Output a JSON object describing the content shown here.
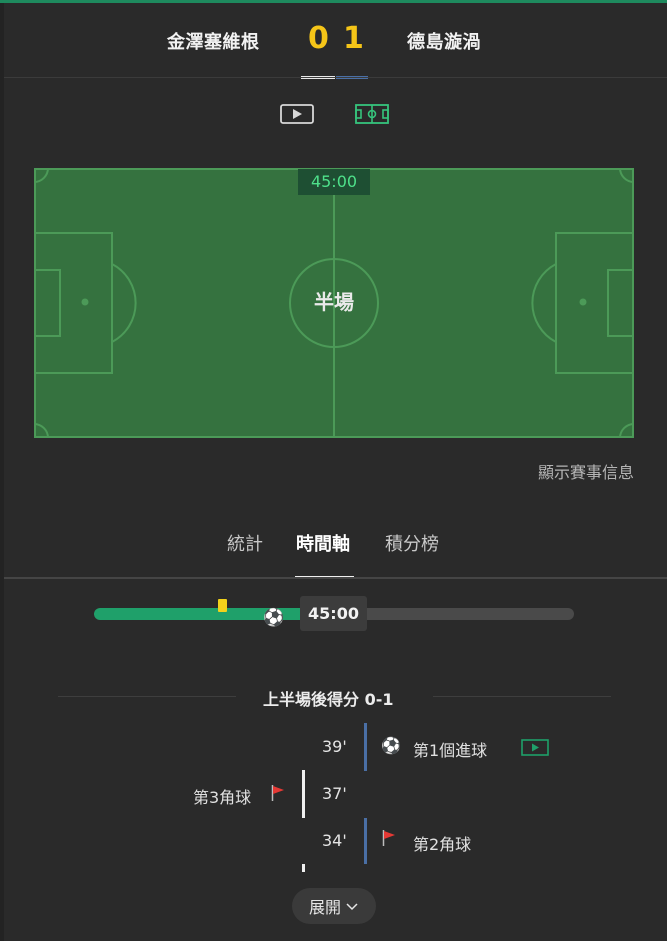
{
  "match": {
    "home_team": "金澤塞維根",
    "away_team": "德島漩渦",
    "home_score": "0",
    "away_score": "1"
  },
  "views": {
    "video_icon": "video-play-icon",
    "pitch_icon": "pitch-icon"
  },
  "pitch": {
    "time": "45:00",
    "status": "半場"
  },
  "show_info": "顯示賽事信息",
  "tabs": {
    "stats": "統計",
    "timeline": "時間軸",
    "standings": "積分榜",
    "active": "timeline"
  },
  "progress": {
    "time": "45:00",
    "fraction": 0.5,
    "events": [
      {
        "type": "yellow-card",
        "minute": 39
      },
      {
        "type": "goal",
        "minute": 39
      }
    ]
  },
  "timeline": {
    "section_title": "上半場後得分 0-1",
    "events": [
      {
        "minute": "39'",
        "side": "away",
        "icon": "soccer-ball-icon",
        "label": "第1個進球",
        "has_video": true
      },
      {
        "minute": "37'",
        "side": "home",
        "icon": "corner-flag-icon",
        "label": "第3角球",
        "has_video": false
      },
      {
        "minute": "34'",
        "side": "away",
        "icon": "corner-flag-icon",
        "label": "第2角球",
        "has_video": false
      }
    ]
  },
  "expand_label": "展開",
  "colors": {
    "background": "#2a2a2a",
    "pitch": "#35723f",
    "accent_green": "#1fa06a",
    "score_yellow": "#f5c518",
    "away_blue": "#4a6fa5",
    "corner_flag": "#e53935"
  }
}
